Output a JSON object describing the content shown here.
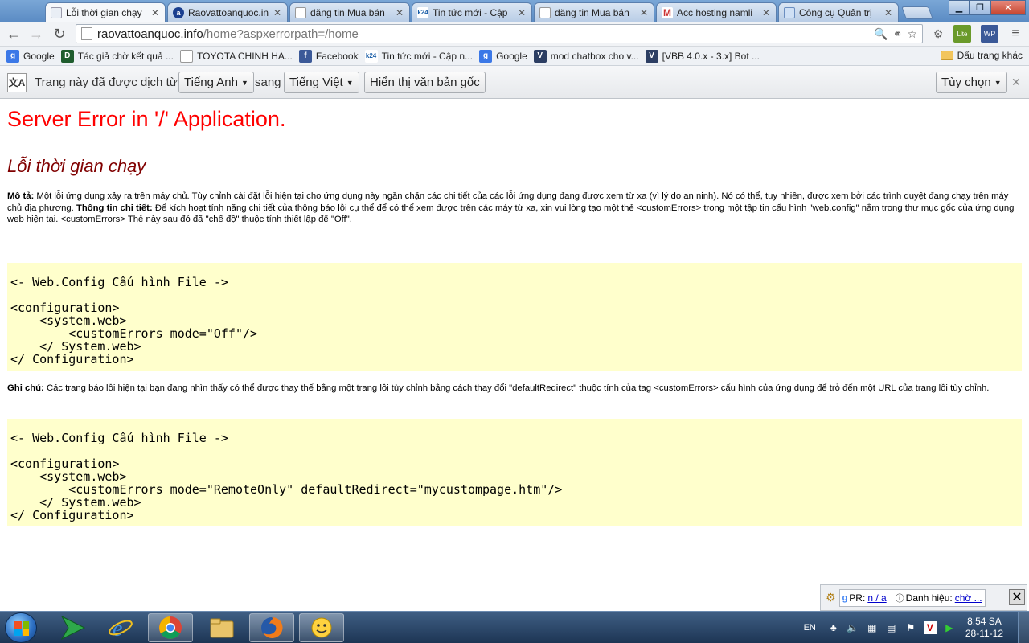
{
  "tabs": [
    {
      "label": "Lỗi thời gian chạy",
      "active": true,
      "favicon": "page-icon"
    },
    {
      "label": "Raovattoanquoc.in",
      "active": false,
      "favicon": "site-icon"
    },
    {
      "label": "đăng tin Mua bán",
      "active": false,
      "favicon": "page-icon"
    },
    {
      "label": "Tin tức mới - Cập",
      "active": false,
      "favicon": "k24-icon"
    },
    {
      "label": "đăng tin Mua bán",
      "active": false,
      "favicon": "page-icon"
    },
    {
      "label": "Acc hosting namli",
      "active": false,
      "favicon": "gmail-icon"
    },
    {
      "label": "Công cụ Quản trị",
      "active": false,
      "favicon": "webmaster-icon"
    }
  ],
  "omnibox": {
    "host": "raovattoanquoc.info",
    "path": "/home?aspxerrorpath=/home"
  },
  "bookmarks": [
    {
      "label": "Google",
      "icon": "google-icon"
    },
    {
      "label": "Tác giả chờ kết quả ...",
      "icon": "d-icon"
    },
    {
      "label": "TOYOTA CHINH HA...",
      "icon": "page-icon"
    },
    {
      "label": "Facebook",
      "icon": "facebook-icon"
    },
    {
      "label": "Tin tức mới - Cập n...",
      "icon": "k24-icon"
    },
    {
      "label": "Google",
      "icon": "google-icon"
    },
    {
      "label": "mod chatbox cho v...",
      "icon": "vbb-icon"
    },
    {
      "label": "[VBB 4.0.x - 3.x] Bot ...",
      "icon": "vbb-icon"
    }
  ],
  "bookmarks_other": "Dấu trang khác",
  "translate": {
    "text1": "Trang này đã được dịch từ",
    "from_lang": "Tiếng Anh",
    "text2": "sang",
    "to_lang": "Tiếng Việt",
    "show_original": "Hiển thị văn bản gốc",
    "options": "Tùy chọn"
  },
  "page": {
    "title": "Server Error in '/' Application.",
    "subtitle": "Lỗi thời gian chạy",
    "desc_label": "Mô tả:",
    "desc_text": " Một lỗi ứng dụng xảy ra trên máy chủ. Tùy chỉnh cài đặt lỗi hiện tại cho ứng dụng này ngăn chặn các chi tiết của các lỗi ứng dụng đang được xem từ xa (vì lý do an ninh). Nó có thể, tuy nhiên, được xem bởi các trình duyệt đang chạy trên máy chủ địa phương. ",
    "detail_label": "Thông tin chi tiết:",
    "detail_text": " Để kích hoạt tính năng chi tiết của thông báo lỗi cụ thể để có thể xem được trên các máy từ xa, xin vui lòng tạo một thẻ <customErrors> trong một tập tin cấu hình \"web.config\" nằm trong thư mục gốc của ứng dụng web hiện tại. <customErrors> Thẻ này sau đó đã \"chế độ\" thuộc tính thiết lập để \"Off\".",
    "code1": "<- Web.Config Cấu hình File ->\n\n<configuration>\n    <system.web>\n        <customErrors mode=\"Off\"/>\n    </ System.web>\n</ Configuration>",
    "note_label": "Ghi chú:",
    "note_text": " Các trang báo lỗi hiện tại bạn đang nhìn thấy có thể được thay thế bằng một trang lỗi tùy chỉnh bằng cách thay đổi \"defaultRedirect\" thuộc tính của tag <customErrors> cấu hình của ứng dụng để trỏ đến một URL của trang lỗi tùy chỉnh.",
    "code2": "<- Web.Config Cấu hình File ->\n\n<configuration>\n    <system.web>\n        <customErrors mode=\"RemoteOnly\" defaultRedirect=\"mycustompage.htm\"/>\n    </ System.web>\n</ Configuration>"
  },
  "addonbar": {
    "pr_label": "PR:",
    "pr_value": "n / a",
    "title_label": "Danh hiệu:",
    "title_value": "chờ ..."
  },
  "taskbar": {
    "lang": "EN",
    "time": "8:54 SA",
    "date": "28-11-12"
  },
  "colors": {
    "error_title": "#ff0000",
    "error_subtitle": "#800000",
    "code_bg": "#ffffcc"
  }
}
